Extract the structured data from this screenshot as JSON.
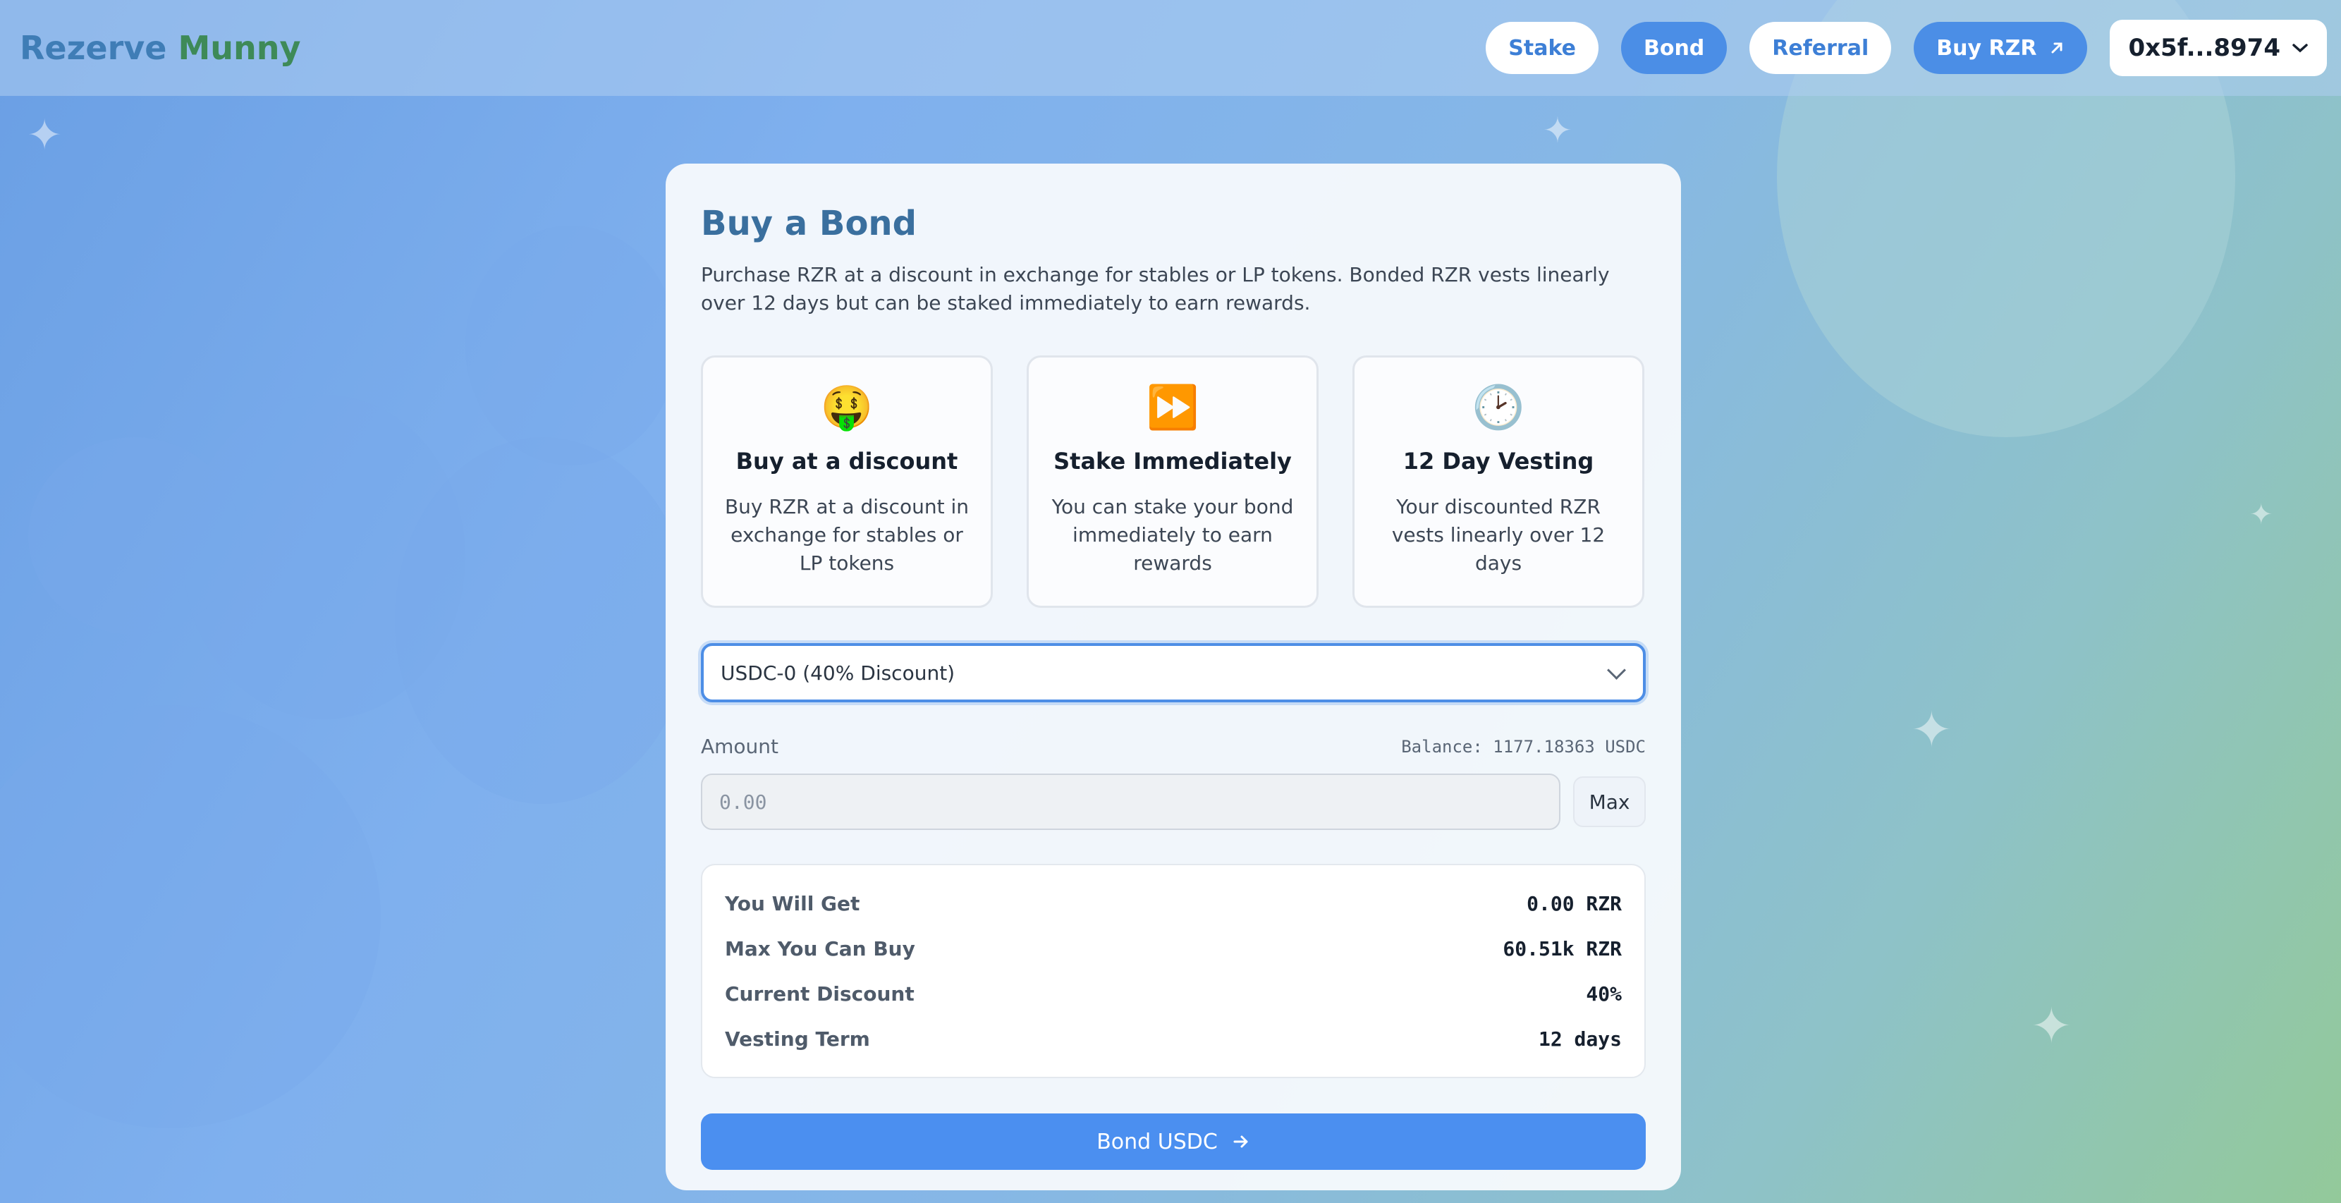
{
  "brand": {
    "word1": "Rezerve",
    "word2": "Munny"
  },
  "nav": {
    "stake": "Stake",
    "bond": "Bond",
    "referral": "Referral",
    "buy": "Buy RZR",
    "wallet": "0x5f...8974"
  },
  "card": {
    "title": "Buy a Bond",
    "description": "Purchase RZR at a discount in exchange for stables or LP tokens. Bonded RZR vests linearly over 12 days but can be staked immediately to earn rewards.",
    "features": [
      {
        "emoji": "🤑",
        "title": "Buy at a discount",
        "text": "Buy RZR at a discount in exchange for stables or LP tokens"
      },
      {
        "emoji": "⏩",
        "title": "Stake Immediately",
        "text": "You can stake your bond immediately to earn rewards"
      },
      {
        "emoji": "🕑",
        "title": "12 Day Vesting",
        "text": "Your discounted RZR vests linearly over 12 days"
      }
    ],
    "select": {
      "value": "USDC-0 (40% Discount)"
    },
    "amount": {
      "label": "Amount",
      "balance": "Balance: 1177.18363 USDC",
      "placeholder": "0.00",
      "max": "Max"
    },
    "summary": [
      {
        "label": "You Will Get",
        "value": "0.00 RZR"
      },
      {
        "label": "Max You Can Buy",
        "value": "60.51k RZR"
      },
      {
        "label": "Current Discount",
        "value": "40%"
      },
      {
        "label": "Vesting Term",
        "value": "12 days"
      }
    ],
    "submit": "Bond USDC"
  },
  "colors": {
    "accent": "#4b8ee6",
    "brand_blue": "#3f7db6",
    "brand_green": "#3e8a58"
  }
}
